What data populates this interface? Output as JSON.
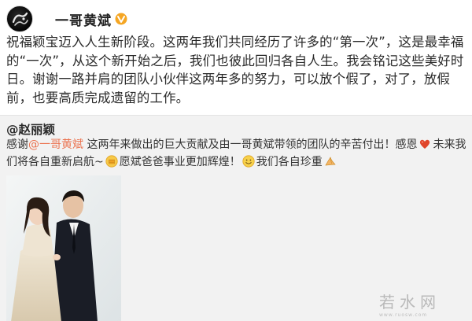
{
  "post": {
    "author": "一哥黄斌",
    "text": "祝福颖宝迈入人生新阶段。这两年我们共同经历了许多的“第一次”，这是最幸福的“一次”，从这个新开始之后，我们也彼此回归各自人生。我会铭记这些美好时日。谢谢一路并肩的团队小伙伴这两年多的努力，可以放个假了，对了，放假前，也要高质完成遗留的工作。"
  },
  "repost": {
    "author": "@赵丽颖",
    "text_1": "感谢",
    "mention": "@一哥黄斌",
    "text_2": " 这两年来做出的巨大贡献及由一哥黄斌带领的团队的辛苦付出！感恩",
    "text_3": "未来我们将各自重新启航~",
    "text_4": "愿斌爸爸事业更加辉煌！",
    "text_5": "我们各自珍重",
    "emoji_names": [
      "heart-icon",
      "fist-salute-icon",
      "smile-icon",
      "praying-hands-icon"
    ]
  },
  "watermark": {
    "text": "若水网",
    "subtext": "www.ruosw.com"
  },
  "colors": {
    "mention": "#eb7350",
    "repost_bg": "#f2f2f2",
    "vip_badge": "#f5a623"
  }
}
